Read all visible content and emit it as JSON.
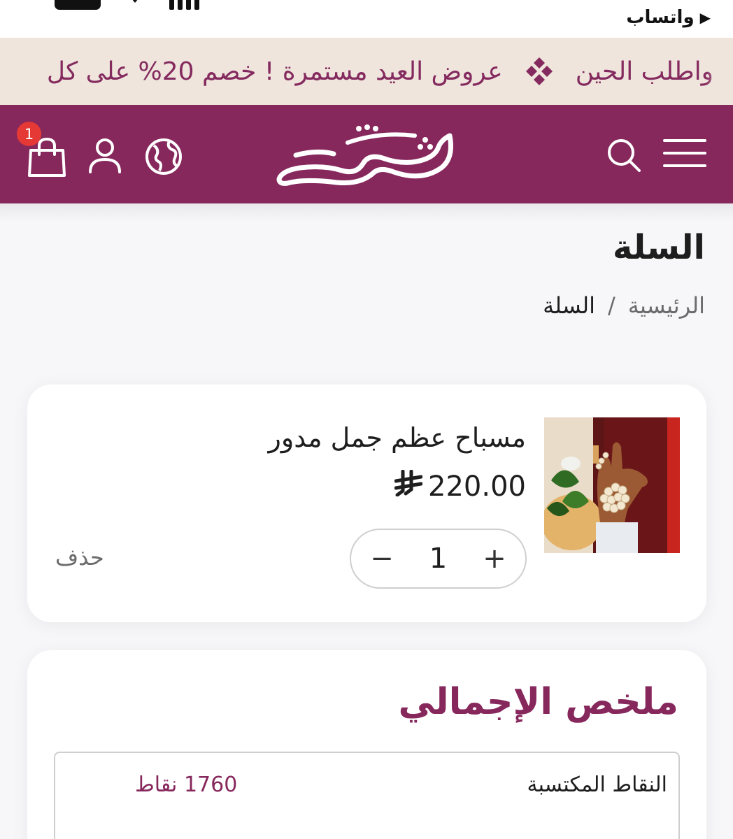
{
  "status_bar": {
    "back_app_label": "واتساب",
    "back_arrow": "▶"
  },
  "promo": {
    "message_1": "عروض العيد مستمرة ! خصم 20% على كل",
    "message_2": "واطلب الحين",
    "separator_icon": "diamond-cluster-icon"
  },
  "header": {
    "brand": "شكة",
    "cart_count": "1",
    "icons": [
      "menu-icon",
      "search-icon",
      "globe-icon",
      "user-icon",
      "shopping-bag-icon"
    ],
    "background_color": "#87285d"
  },
  "page": {
    "title": "السلة",
    "breadcrumb": {
      "home": "الرئيسية",
      "separator": "/",
      "current": "السلة"
    }
  },
  "cart": {
    "items": [
      {
        "name": "مسباح عظم جمل مدور",
        "price": "220.00",
        "currency_icon": "saudi-riyal-icon",
        "quantity": "1",
        "minus_symbol": "−",
        "plus_symbol": "+",
        "delete_label": "حذف"
      }
    ]
  },
  "summary": {
    "title": "ملخص الإجمالي",
    "points_label": "النقاط المكتسبة",
    "points_value": "1760 نقاط"
  },
  "colors": {
    "brand": "#87285d",
    "promo_bg": "#efe5dc",
    "badge": "#e53935"
  }
}
